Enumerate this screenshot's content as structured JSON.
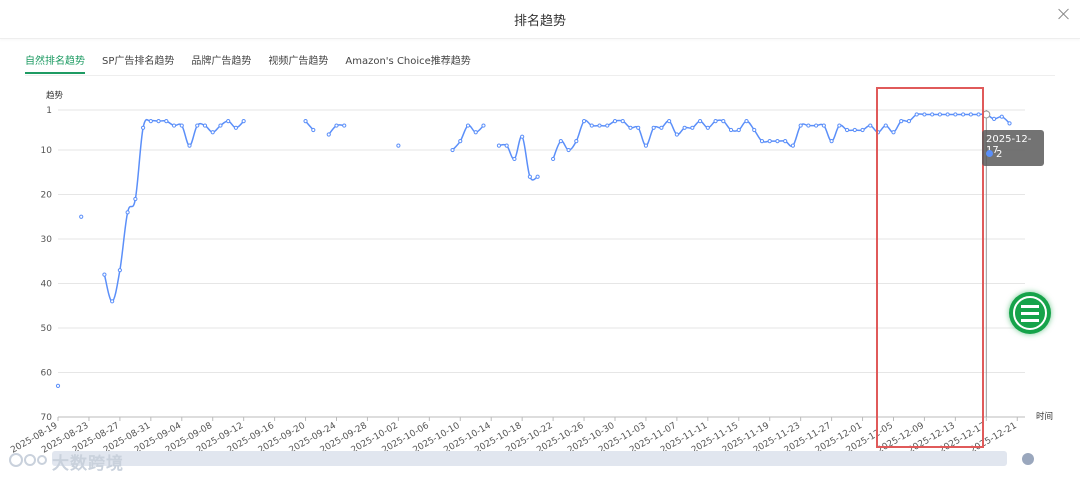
{
  "dialog": {
    "title": "排名趋势"
  },
  "tabs": [
    {
      "label": "自然排名趋势",
      "active": true
    },
    {
      "label": "SP广告排名趋势",
      "active": false
    },
    {
      "label": "品牌广告趋势",
      "active": false
    },
    {
      "label": "视频广告趋势",
      "active": false
    },
    {
      "label": "Amazon's Choice推荐趋势",
      "active": false
    }
  ],
  "tooltip": {
    "date": "2025-12-17",
    "value": "2",
    "dot_color": "#5b8ff9"
  },
  "watermark": {
    "text": "大数跨境",
    "logo": "eye-logo-icon"
  },
  "colors": {
    "accent": "#1e9b63",
    "series": "#5b8ff9",
    "highlight": "#e05a5a",
    "fab": "#16a34a"
  },
  "fab": {
    "icon": "menu-icon"
  },
  "chart_data": {
    "type": "line",
    "ylabel": "趋势",
    "xlabel": "时间",
    "y_inverted": true,
    "ylim": [
      1,
      70
    ],
    "yticks": [
      1,
      10,
      20,
      30,
      40,
      50,
      60,
      70
    ],
    "x_range": [
      "2025-08-19",
      "2025-12-22"
    ],
    "x_ticks": [
      "2025-08-19",
      "2025-08-23",
      "2025-08-27",
      "2025-08-31",
      "2025-09-04",
      "2025-09-08",
      "2025-09-12",
      "2025-09-16",
      "2025-09-20",
      "2025-09-24",
      "2025-09-28",
      "2025-10-02",
      "2025-10-06",
      "2025-10-10",
      "2025-10-14",
      "2025-10-18",
      "2025-10-22",
      "2025-10-26",
      "2025-10-30",
      "2025-11-03",
      "2025-11-07",
      "2025-11-11",
      "2025-11-15",
      "2025-11-19",
      "2025-11-23",
      "2025-11-27",
      "2025-12-01",
      "2025-12-05",
      "2025-12-09",
      "2025-12-13",
      "2025-12-17",
      "2025-12-21"
    ],
    "grid": true,
    "highlight_range": [
      "2025-12-08",
      "2025-12-21"
    ],
    "cursor_date": "2025-12-17",
    "segments": [
      [
        [
          "2025-08-19",
          63
        ]
      ],
      [
        [
          "2025-08-22",
          25
        ]
      ],
      [
        [
          "2025-08-25",
          38
        ],
        [
          "2025-08-26",
          44
        ],
        [
          "2025-08-27",
          37
        ],
        [
          "2025-08-28",
          24
        ],
        [
          "2025-08-29",
          21
        ],
        [
          "2025-08-30",
          5
        ],
        [
          "2025-08-31",
          3.5
        ],
        [
          "2025-09-01",
          3.5
        ],
        [
          "2025-09-02",
          3.5
        ],
        [
          "2025-09-03",
          4.5
        ],
        [
          "2025-09-04",
          4.5
        ],
        [
          "2025-09-05",
          9
        ],
        [
          "2025-09-06",
          4.5
        ],
        [
          "2025-09-07",
          4.5
        ],
        [
          "2025-09-08",
          6
        ],
        [
          "2025-09-09",
          4.5
        ],
        [
          "2025-09-10",
          3.5
        ],
        [
          "2025-09-11",
          5
        ],
        [
          "2025-09-12",
          3.5
        ]
      ],
      [
        [
          "2025-09-20",
          3.5
        ],
        [
          "2025-09-21",
          5.5
        ]
      ],
      [
        [
          "2025-09-23",
          6.5
        ],
        [
          "2025-09-24",
          4.5
        ],
        [
          "2025-09-25",
          4.5
        ]
      ],
      [
        [
          "2025-10-02",
          9
        ]
      ],
      [
        [
          "2025-10-09",
          10
        ],
        [
          "2025-10-10",
          8
        ],
        [
          "2025-10-11",
          4.5
        ],
        [
          "2025-10-12",
          6
        ],
        [
          "2025-10-13",
          4.5
        ]
      ],
      [
        [
          "2025-10-15",
          9
        ],
        [
          "2025-10-16",
          9
        ],
        [
          "2025-10-17",
          12
        ],
        [
          "2025-10-18",
          7
        ],
        [
          "2025-10-19",
          16
        ],
        [
          "2025-10-20",
          16
        ]
      ],
      [
        [
          "2025-10-22",
          12
        ],
        [
          "2025-10-23",
          8
        ],
        [
          "2025-10-24",
          10
        ],
        [
          "2025-10-25",
          8
        ],
        [
          "2025-10-26",
          3.5
        ],
        [
          "2025-10-27",
          4.5
        ],
        [
          "2025-10-28",
          4.5
        ],
        [
          "2025-10-29",
          4.5
        ],
        [
          "2025-10-30",
          3.5
        ],
        [
          "2025-10-31",
          3.5
        ],
        [
          "2025-11-01",
          5
        ],
        [
          "2025-11-02",
          5
        ],
        [
          "2025-11-03",
          9
        ],
        [
          "2025-11-04",
          5
        ],
        [
          "2025-11-05",
          5
        ],
        [
          "2025-11-06",
          3.5
        ],
        [
          "2025-11-07",
          6.5
        ],
        [
          "2025-11-08",
          5
        ],
        [
          "2025-11-09",
          5
        ],
        [
          "2025-11-10",
          3.5
        ],
        [
          "2025-11-11",
          5
        ],
        [
          "2025-11-12",
          3.5
        ],
        [
          "2025-11-13",
          3.5
        ],
        [
          "2025-11-14",
          5.5
        ],
        [
          "2025-11-15",
          5.5
        ],
        [
          "2025-11-16",
          3.5
        ],
        [
          "2025-11-17",
          5.5
        ],
        [
          "2025-11-18",
          8
        ],
        [
          "2025-11-19",
          8
        ],
        [
          "2025-11-20",
          8
        ],
        [
          "2025-11-21",
          8
        ],
        [
          "2025-11-22",
          9
        ],
        [
          "2025-11-23",
          4.5
        ],
        [
          "2025-11-24",
          4.5
        ],
        [
          "2025-11-25",
          4.5
        ],
        [
          "2025-11-26",
          4.5
        ],
        [
          "2025-11-27",
          8
        ],
        [
          "2025-11-28",
          4.5
        ],
        [
          "2025-11-29",
          5.5
        ],
        [
          "2025-11-30",
          5.5
        ],
        [
          "2025-12-01",
          5.5
        ],
        [
          "2025-12-02",
          4.5
        ],
        [
          "2025-12-03",
          6
        ],
        [
          "2025-12-04",
          4.5
        ],
        [
          "2025-12-05",
          6
        ],
        [
          "2025-12-06",
          3.5
        ],
        [
          "2025-12-07",
          3.5
        ],
        [
          "2025-12-08",
          2
        ],
        [
          "2025-12-09",
          2
        ],
        [
          "2025-12-10",
          2
        ],
        [
          "2025-12-11",
          2
        ],
        [
          "2025-12-12",
          2
        ],
        [
          "2025-12-13",
          2
        ],
        [
          "2025-12-14",
          2
        ],
        [
          "2025-12-15",
          2
        ],
        [
          "2025-12-16",
          2
        ],
        [
          "2025-12-17",
          2
        ],
        [
          "2025-12-18",
          3
        ],
        [
          "2025-12-19",
          2.5
        ],
        [
          "2025-12-20",
          4
        ]
      ]
    ]
  }
}
